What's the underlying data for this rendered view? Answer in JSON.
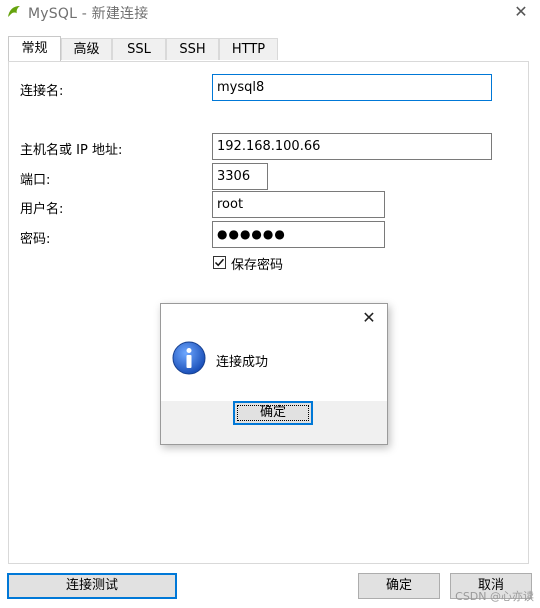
{
  "window": {
    "title": "MySQL - 新建连接",
    "close_glyph": "✕",
    "app_icon": "mysql-dolphin-icon",
    "brand_color": "#65a30d"
  },
  "tabs": [
    {
      "label": "常规",
      "active": true
    },
    {
      "label": "高级",
      "active": false
    },
    {
      "label": "SSL",
      "active": false
    },
    {
      "label": "SSH",
      "active": false
    },
    {
      "label": "HTTP",
      "active": false
    }
  ],
  "form": {
    "connection_name": {
      "label": "连接名:",
      "value": "mysql8"
    },
    "host": {
      "label": "主机名或 IP 地址:",
      "value": "192.168.100.66"
    },
    "port": {
      "label": "端口:",
      "value": "3306"
    },
    "username": {
      "label": "用户名:",
      "value": "root"
    },
    "password": {
      "label": "密码:",
      "value": "●●●●●●"
    },
    "save_password": {
      "label": "保存密码",
      "checked": true
    }
  },
  "buttons": {
    "test_connection": "连接测试",
    "ok": "确定",
    "cancel": "取消"
  },
  "dialog": {
    "message": "连接成功",
    "ok": "确定",
    "close_glyph": "✕",
    "icon": "info-icon",
    "accent": "#0078d7"
  },
  "watermark": "CSDN @心亦读"
}
